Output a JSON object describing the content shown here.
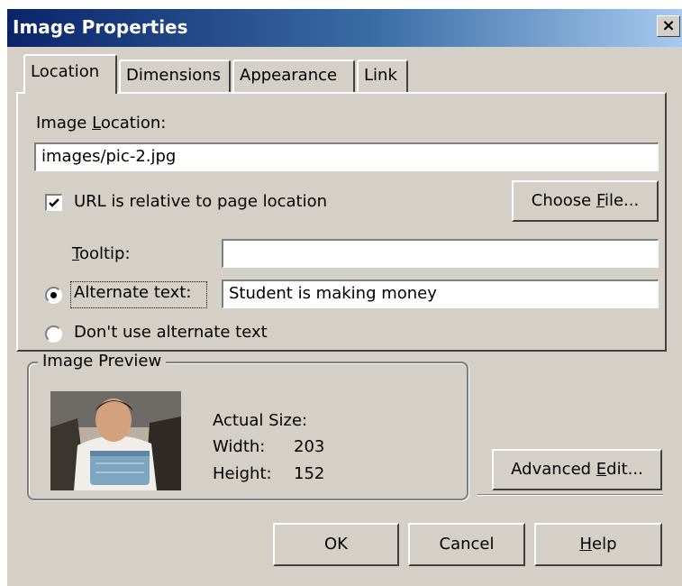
{
  "window": {
    "title": "Image Properties",
    "close_label": "×"
  },
  "tabs": [
    {
      "label": "Location",
      "active": true
    },
    {
      "label": "Dimensions"
    },
    {
      "label": "Appearance"
    },
    {
      "label": "Link"
    }
  ],
  "location": {
    "image_location_label_pre": "Image ",
    "image_location_label_key": "L",
    "image_location_label_post": "ocation:",
    "image_location_value": "images/pic-2.jpg",
    "relative_checkbox_label": "URL is relative to page location",
    "relative_checked": true,
    "choose_file_pre": "Choose ",
    "choose_file_key": "F",
    "choose_file_post": "ile...",
    "tooltip_key": "T",
    "tooltip_post": "ooltip:",
    "tooltip_value": "",
    "alt_text_label": "Alternate text:",
    "alt_text_value": "Student is making money",
    "alt_text_selected": true,
    "no_alt_label": "Don't use alternate text"
  },
  "preview": {
    "group_label": "Image Preview",
    "actual_size_label": "Actual Size:",
    "width_label": "Width:",
    "width_value": "203",
    "height_label": "Height:",
    "height_value": "152",
    "advanced_edit_pre": "Advanced ",
    "advanced_edit_key": "E",
    "advanced_edit_post": "dit..."
  },
  "buttons": {
    "ok": "OK",
    "cancel": "Cancel",
    "help_key": "H",
    "help_post": "elp"
  },
  "icons": {
    "check": "checkmark-icon",
    "radio_selected": "radio-dot-icon",
    "preview": "student-photo-thumbnail"
  }
}
